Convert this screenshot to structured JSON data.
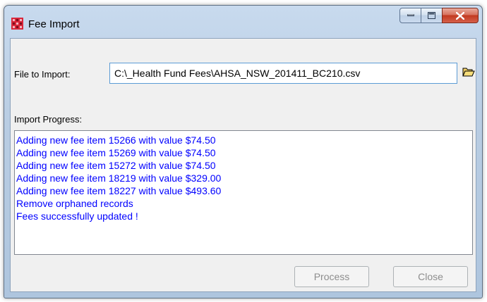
{
  "window": {
    "title": "Fee Import"
  },
  "caption_buttons": {
    "minimize_icon": "minimize-icon",
    "maximize_icon": "maximize-icon",
    "close_icon": "close-icon"
  },
  "file": {
    "label": "File to Import:",
    "value": "C:\\_Health Fund Fees\\AHSA_NSW_201411_BC210.csv",
    "browse_icon": "folder-open-icon"
  },
  "progress": {
    "label": "Import Progress:",
    "lines": [
      "Adding new fee item 15266 with value $74.50",
      "Adding new fee item 15269 with value $74.50",
      "Adding new fee item 15272 with value $74.50",
      "Adding new fee item 18219 with value $329.00",
      "Adding new fee item 18227 with value $493.60",
      "Remove orphaned records",
      "Fees successfully updated !"
    ]
  },
  "buttons": {
    "process_label": "Process",
    "close_label": "Close"
  },
  "colors": {
    "log_text": "#0000ff",
    "close_button": "#c2391f",
    "disabled_text": "#8d8d8d"
  }
}
